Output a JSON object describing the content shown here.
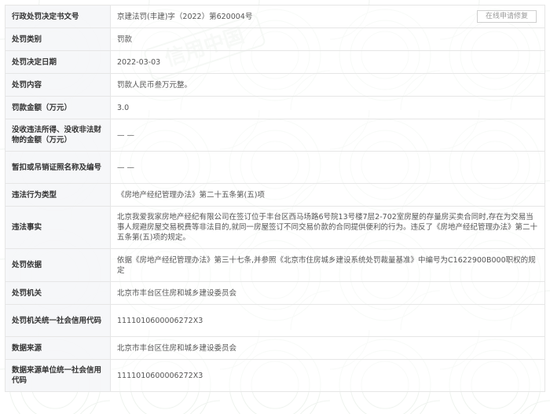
{
  "rows": [
    {
      "label": "行政处罚决定书文号",
      "value": "京建法罚(丰建)字（2022）第620004号"
    },
    {
      "label": "处罚类别",
      "value": "罚款"
    },
    {
      "label": "处罚决定日期",
      "value": "2022-03-03"
    },
    {
      "label": "处罚内容",
      "value": "罚款人民币叁万元整。"
    },
    {
      "label": "罚款金额（万元）",
      "value": "3.0"
    },
    {
      "label": "没收违法所得、没收非法财物的金额（万元）",
      "value": "— —"
    },
    {
      "label": "暂扣或吊销证照名称及编号",
      "value": "— —"
    },
    {
      "label": "违法行为类型",
      "value": "《房地产经纪管理办法》第二十五条第(五)项"
    },
    {
      "label": "违法事实",
      "value": "北京我爱我家房地产经纪有限公司在签订位于丰台区西马场路6号院13号楼7层2-702室房屋的存量房买卖合同时,存在为交易当事人规避房屋交易税费等非法目的,就同一房屋签订不同交易价款的合同提供便利的行为。违反了《房地产经纪管理办法》第二十五条第(五)项的规定。"
    },
    {
      "label": "处罚依据",
      "value": "依据《房地产经纪管理办法》第三十七条,并参照《北京市住房城乡建设系统处罚裁量基准》中编号为C1622900B000职权的规定"
    },
    {
      "label": "处罚机关",
      "value": "北京市丰台区住房和城乡建设委员会"
    },
    {
      "label": "处罚机关统一社会信用代码",
      "value": "1111010600006272X3"
    },
    {
      "label": "数据来源",
      "value": "北京市丰台区住房和城乡建设委员会"
    },
    {
      "label": "数据来源单位统一社会信用代码",
      "value": "1111010600006272X3"
    }
  ],
  "repair_button": {
    "label": "在线申请修复"
  },
  "watermark": {
    "text": "信用中国"
  }
}
